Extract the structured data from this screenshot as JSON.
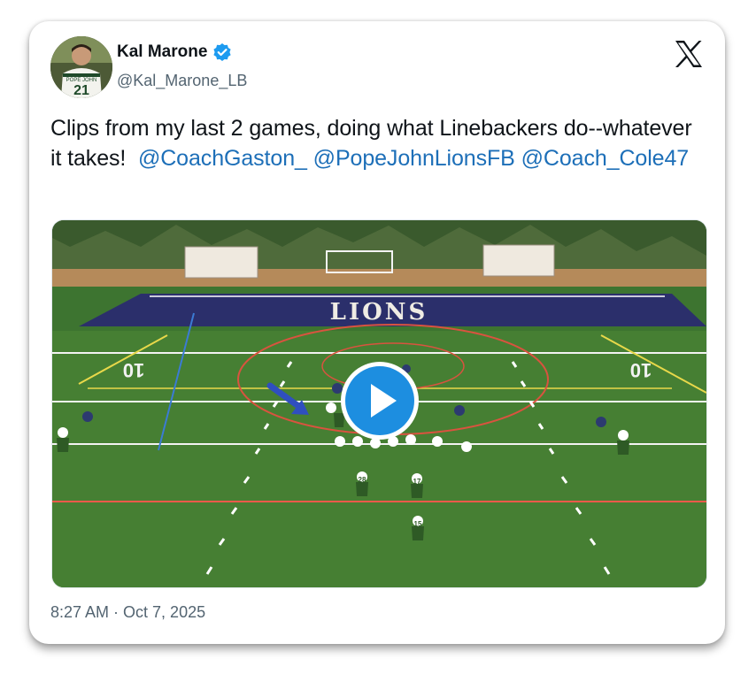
{
  "author": {
    "display_name": "Kal Marone",
    "handle": "@Kal_Marone_LB",
    "avatar": "player-photo",
    "jersey_text": "POPE JOHN",
    "jersey_number": "21",
    "verified": true
  },
  "tweet": {
    "text_main": "Clips from my last 2 games, doing what Linebackers do--whatever it takes!",
    "mentions": [
      "@CoachGaston_",
      "@PopeJohnLionsFB",
      "@Coach_Cole47"
    ]
  },
  "media": {
    "type": "video",
    "field_text": "LIONS",
    "yard_left": "10",
    "yard_right": "10",
    "player_numbers": [
      "28",
      "17",
      "15"
    ]
  },
  "timestamp": "8:27 AM · Oct 7, 2025",
  "icons": {
    "logo": "x-logo-icon",
    "verified": "verified-badge-icon",
    "play": "play-icon"
  },
  "colors": {
    "mention": "#1d6fb8",
    "verified": "#1d9bf0",
    "play": "#1d8ee0",
    "endzone": "#2b2f6b",
    "turf": "#3f7e2e"
  }
}
